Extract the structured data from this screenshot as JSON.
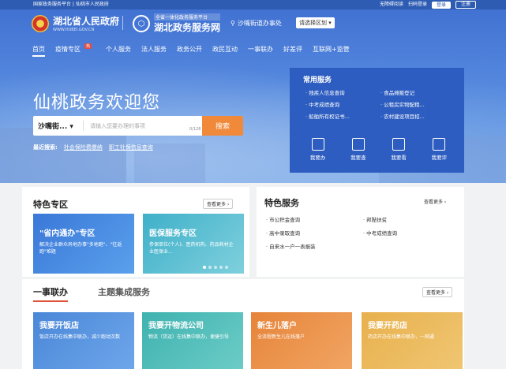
{
  "topbar": {
    "left": "国家政务服务平台 | 仙桃市人民政府",
    "accessibility": "无障碍阅读",
    "scan": "扫码登录",
    "login": "登录",
    "register": "注册"
  },
  "header": {
    "gov_title": "湖北省人民政府",
    "gov_sub": "WWW.HUBEI.GOV.CN",
    "platform_small": "全省一体化政务服务平台",
    "platform_title": "湖北政务服务网",
    "location": "沙嘴街道办事处",
    "region_select": "请选择区划"
  },
  "nav": [
    {
      "label": "首页"
    },
    {
      "label": "疫情专区"
    },
    {
      "label": "个人服务"
    },
    {
      "label": "法人服务"
    },
    {
      "label": "政务公开"
    },
    {
      "label": "政民互动"
    },
    {
      "label": "一事联办"
    },
    {
      "label": "好差评"
    },
    {
      "label": "互联网+监管"
    }
  ],
  "nav_hot": "热",
  "hero": {
    "welcome": "仙桃政务欢迎您",
    "search_scope": "沙嘴街...",
    "search_placeholder": "请输入您要办理的事项",
    "search_count": "0/128",
    "search_btn": "搜索",
    "hot_label": "最近搜索:",
    "hot_items": [
      "社会保险费缴纳",
      "职工社保信息查询"
    ]
  },
  "common": {
    "title": "常用服务",
    "items": [
      "残疾人信息查询",
      "食品摊贩登记",
      "中考成绩查询",
      "公租房实物配租...",
      "船舶所有权证书...",
      "农村建设项目招..."
    ],
    "icons": [
      {
        "label": "我要办",
        "icon": "handle-icon"
      },
      {
        "label": "我要查",
        "icon": "query-icon"
      },
      {
        "label": "我要看",
        "icon": "view-icon"
      },
      {
        "label": "我要评",
        "icon": "rate-icon"
      }
    ]
  },
  "feature": {
    "title": "特色专区",
    "more": "查看更多",
    "banner1_title": "\"省内通办\"专区",
    "banner1_desc": "解决企业群众异地办事\"多地跑\"、\"往返跑\"难题",
    "banner2_title": "医保服务专区",
    "banner2_desc": "参保单位(个人)、医药机构、药品耗材企业医保业..."
  },
  "special": {
    "title": "特色服务",
    "more": "查看更多",
    "items": [
      "市公积金查询",
      "邦陛扶贫",
      "高中录取查询",
      "中考成绩查询",
      "自来水一户一表报装"
    ]
  },
  "joint": {
    "tab1": "一事联办",
    "tab2": "主题集成服务",
    "more": "查看更多",
    "tiles": [
      {
        "title": "我要开饭店",
        "desc": "饭店开办在线集中联办，减少跑动次数",
        "color": "#4a87d8"
      },
      {
        "title": "我要开物流公司",
        "desc": "物流（货运）在线集中联办，便捷引导",
        "color": "#3fb2b0"
      },
      {
        "title": "新生儿落户",
        "desc": "全流程新生儿在线落户",
        "color": "#e6843a"
      },
      {
        "title": "我要开药店",
        "desc": "药店开办在线集中联办，一网通",
        "color": "#e8b04d"
      }
    ]
  }
}
